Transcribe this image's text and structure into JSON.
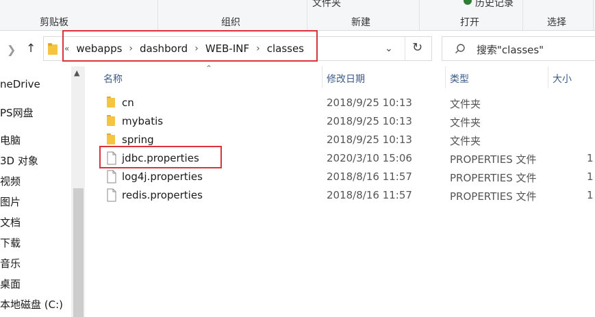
{
  "ribbon": {
    "groups": [
      "剪贴板",
      "组织",
      "新建",
      "打开",
      "选择"
    ],
    "top_partial": [
      "文件夹",
      "历史记录"
    ]
  },
  "address": {
    "overflow_glyph": "«",
    "crumbs": [
      "webapps",
      "dashbord",
      "WEB-INF",
      "classes"
    ]
  },
  "search": {
    "placeholder": "搜索\"classes\""
  },
  "sidebar": {
    "items": [
      "neDrive",
      "PS网盘",
      "电脑",
      "3D 对象",
      "视频",
      "图片",
      "文档",
      "下载",
      "音乐",
      "桌面",
      "本地磁盘 (C:)"
    ]
  },
  "list": {
    "columns": [
      "名称",
      "修改日期",
      "类型",
      "大小"
    ],
    "rows": [
      {
        "name": "cn",
        "date": "2018/9/25 10:13",
        "type": "文件夹",
        "size": "",
        "kind": "folder"
      },
      {
        "name": "mybatis",
        "date": "2018/9/25 10:13",
        "type": "文件夹",
        "size": "",
        "kind": "folder"
      },
      {
        "name": "spring",
        "date": "2018/9/25 10:13",
        "type": "文件夹",
        "size": "",
        "kind": "folder"
      },
      {
        "name": "jdbc.properties",
        "date": "2020/3/10 15:06",
        "type": "PROPERTIES 文件",
        "size": "1",
        "kind": "file"
      },
      {
        "name": "log4j.properties",
        "date": "2018/8/16 11:57",
        "type": "PROPERTIES 文件",
        "size": "1",
        "kind": "file"
      },
      {
        "name": "redis.properties",
        "date": "2018/8/16 11:57",
        "type": "PROPERTIES 文件",
        "size": "1",
        "kind": "file"
      }
    ]
  },
  "colors": {
    "highlight": "#d9333a",
    "folder": "#f5c542",
    "header_text": "#3b5b8a"
  }
}
